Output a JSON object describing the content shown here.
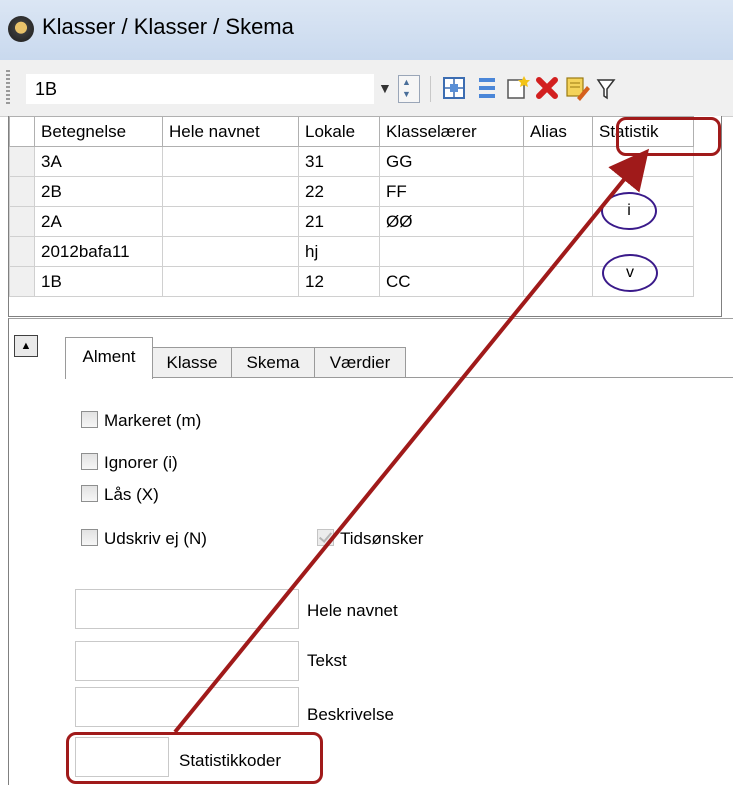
{
  "window": {
    "title": "Klasser / Klasser / Skema"
  },
  "toolbar": {
    "combo_value": "1B",
    "icons": [
      "dropdown-arrow-icon",
      "spin-icon",
      "grid-icon",
      "list-icon",
      "new-icon",
      "delete-icon",
      "edit-icon",
      "filter-icon"
    ]
  },
  "grid": {
    "columns": [
      "Betegnelse",
      "Hele navnet",
      "Lokale",
      "Klasselærer",
      "Alias",
      "Statistik"
    ],
    "rows": [
      {
        "betegnelse": "3A",
        "hele_navnet": "",
        "lokale": "31",
        "klasselaerer": "GG",
        "alias": "",
        "statistik": ""
      },
      {
        "betegnelse": "2B",
        "hele_navnet": "",
        "lokale": "22",
        "klasselaerer": "FF",
        "alias": "",
        "statistik": ""
      },
      {
        "betegnelse": "2A",
        "hele_navnet": "",
        "lokale": "21",
        "klasselaerer": "ØØ",
        "alias": "",
        "statistik": ""
      },
      {
        "betegnelse": "2012bafa11",
        "hele_navnet": "",
        "lokale": "hj",
        "klasselaerer": "",
        "alias": "",
        "statistik": ""
      },
      {
        "betegnelse": "1B",
        "hele_navnet": "",
        "lokale": "12",
        "klasselaerer": "CC",
        "alias": "",
        "statistik": ""
      }
    ]
  },
  "annotations": {
    "circle_1": "i",
    "circle_2": "v",
    "accent_color": "#a01a1a",
    "circle_color": "#3a1a8a"
  },
  "tabs": [
    {
      "label": "Alment"
    },
    {
      "label": "Klasse"
    },
    {
      "label": "Skema"
    },
    {
      "label": "Værdier"
    }
  ],
  "form": {
    "checkboxes": {
      "markeret": "Markeret (m)",
      "ignorer": "Ignorer (i)",
      "laas": "Lås (X)",
      "udskriv": "Udskriv ej (N)",
      "tidsonsker": "Tidsønsker"
    },
    "fields": {
      "hele_navnet": {
        "label": "Hele navnet",
        "value": ""
      },
      "tekst": {
        "label": "Tekst",
        "value": ""
      },
      "beskrivelse": {
        "label": "Beskrivelse",
        "value": ""
      },
      "statistikkoder": {
        "label": "Statistikkoder",
        "value": ""
      }
    }
  }
}
